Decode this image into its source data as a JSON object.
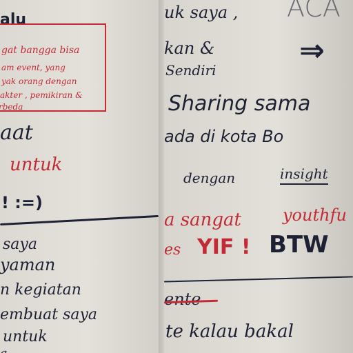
{
  "left": {
    "heading": "alu",
    "box_lines": [
      "gat bangga bisa",
      "am  event, yang",
      "yak  orang dengan",
      "akter , pemikiran &",
      "rbeda"
    ],
    "line_aat": "aat",
    "line_untuk": "untuk",
    "line_emoji": "! :=)",
    "list": [
      "saya",
      "yaman",
      "n kegiatan",
      "embuat saya",
      "untuk",
      "a"
    ]
  },
  "right": {
    "line1": "uk saya ,",
    "line2": "kan &",
    "line3": "Sendiri",
    "top_corner": "ACA",
    "arrow_symbol": "⇒",
    "line4": "Sharing sama",
    "line5": "ada  di kota  Bo",
    "line6": "dengan",
    "line6_underlined": "insight",
    "line7": "a   sangat",
    "line7_right": "youthfu",
    "line8_left": "es",
    "line8_yif": "YIF !",
    "line8_btw": "BTW",
    "struck": "ente",
    "line9": "te   kalau  bakal"
  },
  "colors": {
    "ink": "#1e2133",
    "red": "#c22b35",
    "board": "#dfdcd6"
  }
}
